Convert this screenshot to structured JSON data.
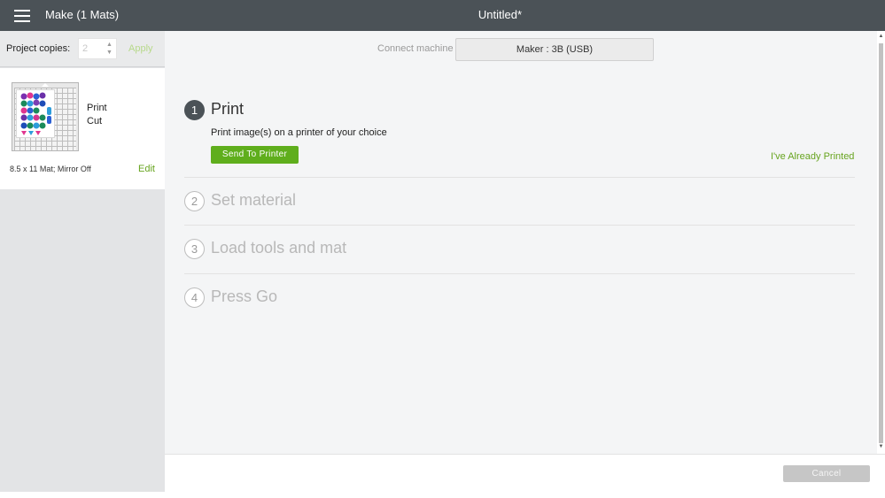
{
  "header": {
    "menu_icon": "hamburger-menu-icon",
    "app_title": "Make (1 Mats)",
    "document_title": "Untitled*"
  },
  "sidebar": {
    "copies_label": "Project copies:",
    "copies_value": "2",
    "apply_label": "Apply",
    "mats": [
      {
        "lines": [
          "Print",
          "Cut"
        ],
        "size_info": "8.5 x 11 Mat; Mirror Off",
        "edit_label": "Edit"
      }
    ]
  },
  "machine": {
    "connect_label": "Connect machine",
    "selected": "Maker : 3B (USB)"
  },
  "steps": [
    {
      "number": "1",
      "title": "Print",
      "state": "active",
      "description": "Print image(s) on a printer of your choice",
      "action_label": "Send To Printer",
      "secondary_label": "I've Already Printed"
    },
    {
      "number": "2",
      "title": "Set material",
      "state": "inactive"
    },
    {
      "number": "3",
      "title": "Load tools and mat",
      "state": "inactive"
    },
    {
      "number": "4",
      "title": "Press Go",
      "state": "inactive"
    }
  ],
  "footer": {
    "cancel_label": "Cancel"
  },
  "colors": {
    "topbar": "#4b5257",
    "accent_green": "#5fae1c",
    "link_green": "#67a41f",
    "panel_bg": "#f4f5f6"
  }
}
